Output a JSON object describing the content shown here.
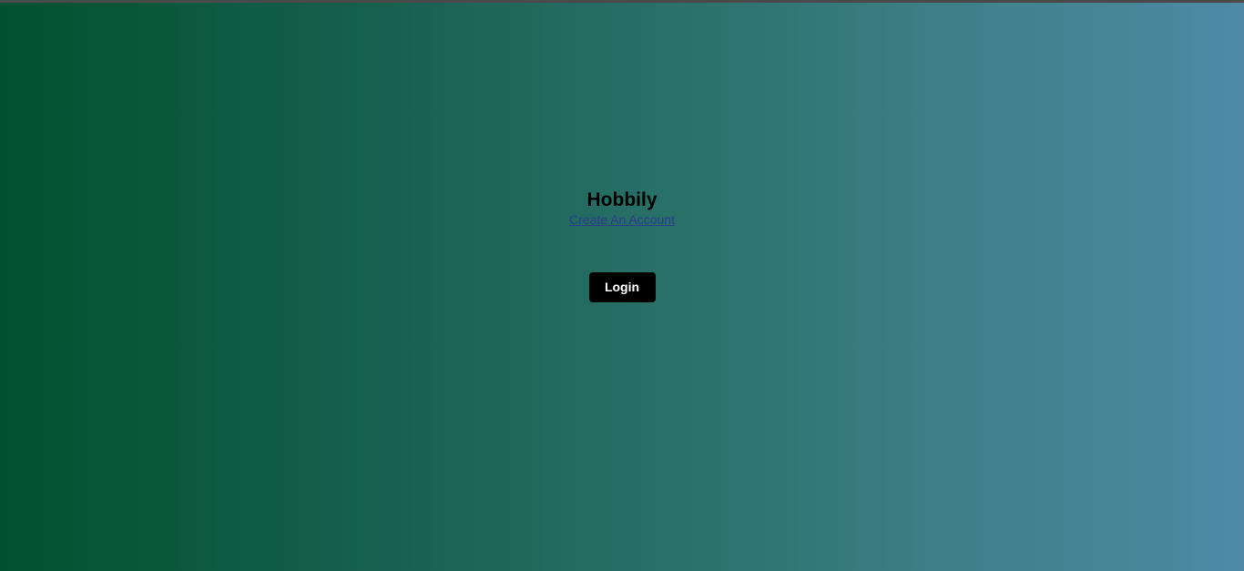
{
  "app": {
    "title": "Hobbily"
  },
  "links": {
    "create_account": "Create An Account"
  },
  "actions": {
    "login_label": "Login"
  },
  "colors": {
    "gradient_start": "#03512f",
    "gradient_end": "#4e8aa6",
    "button_bg": "#000000",
    "button_text": "#ffffff",
    "link": "#2b3a8a"
  }
}
